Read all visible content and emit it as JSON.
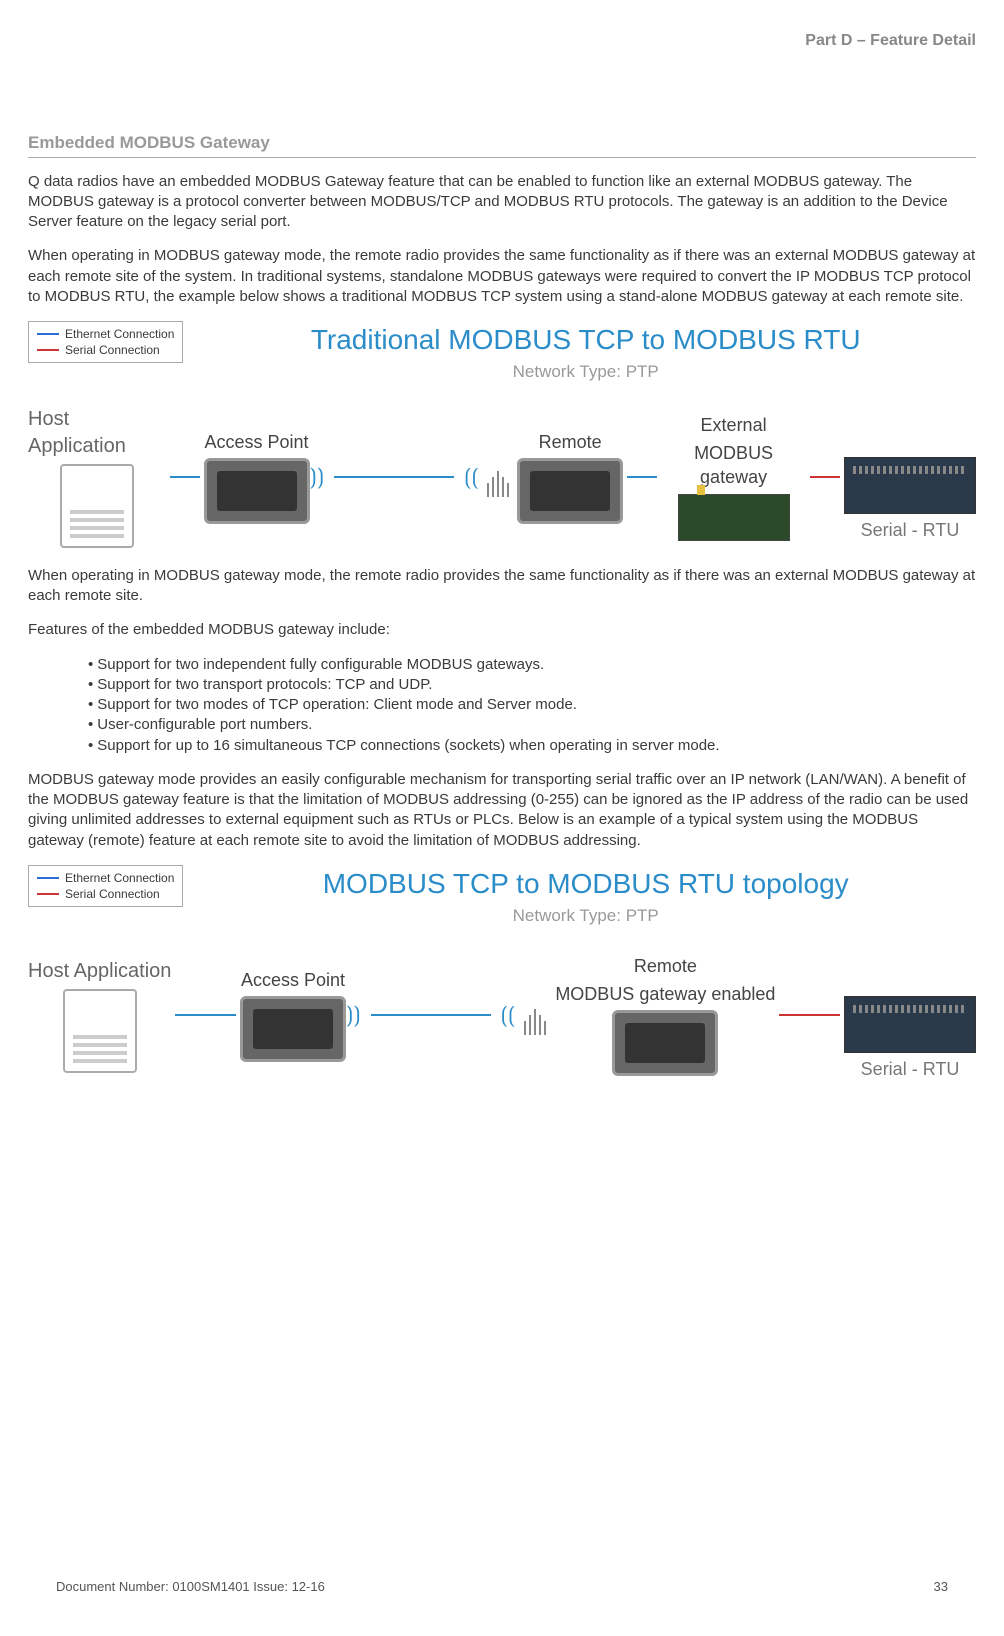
{
  "header": {
    "part": "Part D – Feature Detail"
  },
  "section": {
    "title": "Embedded MODBUS Gateway"
  },
  "paragraphs": {
    "p1": "Q data radios have an embedded MODBUS Gateway feature that can be enabled to function like an external MODBUS gateway. The MODBUS gateway is a protocol converter between MODBUS/TCP and MODBUS RTU protocols. The gateway is an addition to the Device Server feature on the legacy serial port.",
    "p2": "When operating in MODBUS gateway mode, the remote radio provides the same functionality as if there was an external MODBUS gateway at each remote site of the system. In traditional systems, standalone MODBUS gateways were required to convert the IP MODBUS TCP protocol to MODBUS RTU, the example below shows a traditional MODBUS TCP system using a stand-alone MODBUS gateway at each remote site.",
    "p3": "When operating in MODBUS gateway mode, the remote radio provides the same functionality as if there was an external MODBUS gateway at each remote site.",
    "p4": "Features of the embedded MODBUS gateway include:",
    "p5": "MODBUS gateway mode provides an easily configurable mechanism for transporting serial traffic over an IP network (LAN/WAN). A benefit of the MODBUS gateway feature is that the limitation of MODBUS addressing (0-255) can be ignored as the IP address of the radio can be used giving unlimited addresses to external equipment such as RTUs or PLCs. Below is an example of a typical system using the MODBUS gateway (remote) feature at each remote site to avoid the limitation of MODBUS addressing."
  },
  "bullets": [
    "Support for two independent fully configurable MODBUS gateways.",
    "Support for two transport protocols: TCP and UDP.",
    "Support for two modes of TCP operation: Client mode and Server mode.",
    "User-configurable port numbers.",
    "Support for up to 16 simultaneous TCP connections (sockets) when operating in server mode."
  ],
  "diagram1": {
    "title": "Traditional MODBUS TCP to MODBUS RTU",
    "subtitle": "Network Type: PTP",
    "legend_eth": "Ethernet Connection",
    "legend_ser": "Serial Connection",
    "host": "Host Application",
    "ap": "Access Point",
    "remote": "Remote",
    "ext_gw_l1": "External",
    "ext_gw_l2": "MODBUS gateway",
    "serial_rtu": "Serial - RTU"
  },
  "diagram2": {
    "title": "MODBUS TCP to MODBUS RTU topology",
    "subtitle": "Network Type: PTP",
    "legend_eth": "Ethernet Connection",
    "legend_ser": "Serial Connection",
    "host": "Host Application",
    "ap": "Access Point",
    "remote_l1": "Remote",
    "remote_l2": "MODBUS gateway enabled",
    "serial_rtu": "Serial - RTU"
  },
  "footer": {
    "doc": "Document Number: 0100SM1401   Issue: 12-16",
    "page": "33"
  }
}
